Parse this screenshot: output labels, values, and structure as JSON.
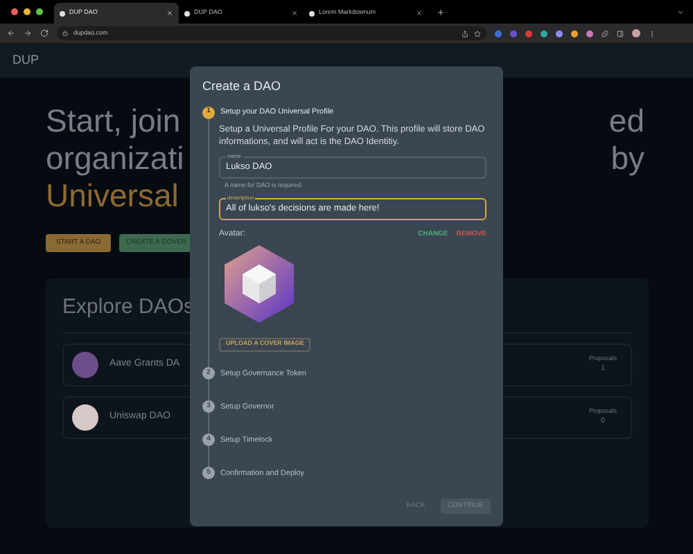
{
  "browser": {
    "tabs": [
      {
        "title": "DUP DAO",
        "selected": true
      },
      {
        "title": "DUP DAO",
        "selected": false
      },
      {
        "title": "Lorem Markdownum",
        "selected": false
      }
    ],
    "address": "dupdao.com"
  },
  "header": {
    "logo": "DUP"
  },
  "hero": {
    "lines": [
      {
        "left": "Start, join",
        "right": "ed",
        "accent": false
      },
      {
        "left": "organizati",
        "right": "by",
        "accent": false
      },
      {
        "left": "Universal",
        "accent": true
      }
    ]
  },
  "actions": [
    {
      "label": "START A DAO",
      "kind": "primary"
    },
    {
      "label": "CREATE A GOVER",
      "kind": "secondary"
    }
  ],
  "explore": {
    "title": "Explore DAOs",
    "daos": [
      {
        "name": "Aave Grants DA",
        "proposals_label": "Proposals",
        "proposals": "1",
        "color": "#6b4e8a"
      },
      {
        "name": "Uniswap DAO",
        "proposals_label": "Proposals",
        "proposals": "0",
        "color": "#d9c8c8"
      }
    ]
  },
  "dialog": {
    "title": "Create a DAO",
    "steps": [
      {
        "number": "1",
        "label": "Setup your DAO Universal Profile",
        "active": true
      },
      {
        "number": "2",
        "label": "Setup Governance Token",
        "active": false
      },
      {
        "number": "3",
        "label": "Setup Governor",
        "active": false
      },
      {
        "number": "4",
        "label": "Setup Timelock",
        "active": false
      },
      {
        "number": "5",
        "label": "Confirmation and Deploy",
        "active": false
      }
    ],
    "intro": "Setup a Universal Profile For your DAO. This profile will store DAO informations, and will act is the DAO Identitiy.",
    "fields": [
      {
        "label": "name",
        "value": "Lukso DAO",
        "helper": "A name for DAO is required.",
        "focused": false
      },
      {
        "label": "description",
        "value": "All of lukso's decisions are made here!",
        "focused": true
      }
    ],
    "avatar_label": "Avatar:",
    "change": "CHANGE",
    "remove": "REMOVE",
    "upload": "UPLOAD A COVER IMAGE",
    "back": {
      "label": "BACK",
      "disabled": true
    },
    "continue": {
      "label": "CONTINUE",
      "disabled": true
    }
  }
}
